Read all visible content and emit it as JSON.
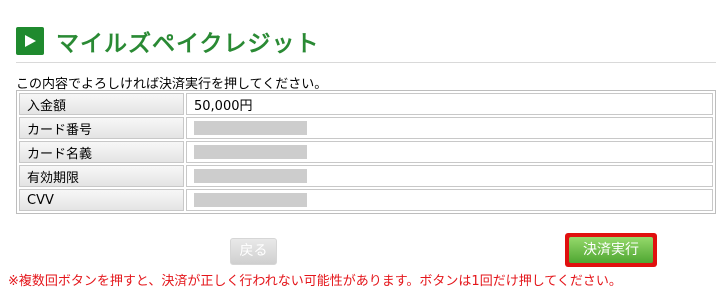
{
  "header": {
    "title": "マイルズペイクレジット",
    "icon": "play-arrow-icon"
  },
  "intro": "この内容でよろしければ決済実行を押してください。",
  "details": [
    {
      "label": "入金額",
      "value": "50,000円",
      "masked": false
    },
    {
      "label": "カード番号",
      "value": "",
      "masked": true
    },
    {
      "label": "カード名義",
      "value": "",
      "masked": true
    },
    {
      "label": "有効期限",
      "value": "",
      "masked": true
    },
    {
      "label": "CVV",
      "value": "",
      "masked": true
    }
  ],
  "actions": {
    "back_label": "戻る",
    "submit_label": "決済実行"
  },
  "warning": "※複数回ボタンを押すと、決済が正しく行われない可能性があります。ボタンは1回だけ押してください。",
  "colors": {
    "title_green": "#2a8a34",
    "highlight_red": "#e0100f",
    "warning_red": "#e4151a"
  }
}
